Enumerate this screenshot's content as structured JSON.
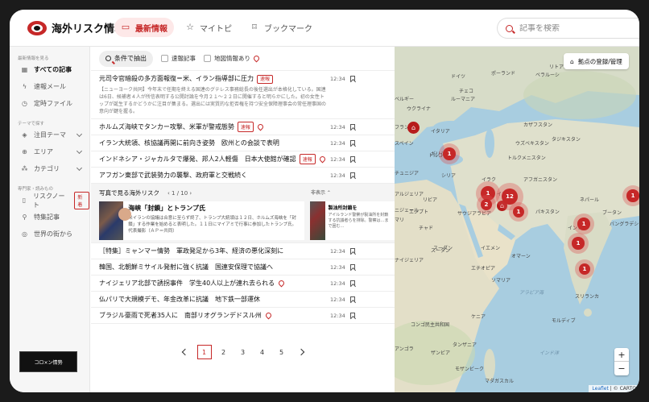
{
  "header": {
    "logo_text": "海外リスク情報",
    "nav": [
      {
        "label": "最新情報",
        "icon": "monitor-icon",
        "active": true
      },
      {
        "label": "マイトピ",
        "icon": "star-icon",
        "active": false
      },
      {
        "label": "ブックマーク",
        "icon": "bookmark-icon",
        "active": false
      }
    ],
    "search_placeholder": "記事を検索"
  },
  "sidebar": {
    "section1_label": "最新情報を見る",
    "items1": [
      {
        "label": "すべての記事",
        "icon": "grid-icon"
      },
      {
        "label": "速報メール",
        "icon": "bolt-icon"
      },
      {
        "label": "定時ファイル",
        "icon": "clock-icon"
      }
    ],
    "section2_label": "テーマで探す",
    "items2": [
      {
        "label": "注目テーマ",
        "icon": "tag-icon"
      },
      {
        "label": "エリア",
        "icon": "globe-icon"
      },
      {
        "label": "カテゴリ",
        "icon": "category-icon"
      }
    ],
    "section3_label": "専門家・読みもの",
    "items3": [
      {
        "label": "リスクノート",
        "icon": "note-icon",
        "badge": "新着"
      },
      {
        "label": "特集記事",
        "icon": "medal-icon"
      },
      {
        "label": "世界の街から",
        "icon": "globe2-icon"
      }
    ],
    "banner_text": "コロ×ン情勢"
  },
  "feed": {
    "filter_button": "条件で抽出",
    "check_breaking": "速報記事",
    "check_map": "地図情報あり",
    "news_top": [
      {
        "title": "元司令官暗殺の多方面報復＝米、イラン指導部に圧力",
        "time": "12:34",
        "tag": "速報",
        "pin": false
      }
    ],
    "expanded": {
      "title": "元司令官暗殺の多方面報復＝米、イラン指導部に圧力",
      "time": "12:34",
      "body": "【ニューヨーク共同】今年末で任期を終える国連のグテレス事務総長の後任選出が本格化している。国連は6日、候補者４人が所信表明する公開討論を今月２１～２２日に開催すると明らかにした。初の女性トップが誕生するかどうかに注目が集まる。選出には実質的な拒否権を持つ安全保障理事会の常任理事国の意向が鍵を握る。"
    },
    "news_mid": [
      {
        "title": "ホルムズ海峡でタンカー攻撃、米軍が警戒態勢",
        "time": "12:34",
        "tag": "速報",
        "pin": true
      },
      {
        "title": "イラン大統領、核協議再開に前向き姿勢　欧州との会談で表明",
        "time": "12:34",
        "tag": "",
        "pin": false
      },
      {
        "title": "インドネシア・ジャカルタで爆発、邦人2人軽傷　日本大使館が確認",
        "time": "12:34",
        "tag": "速報",
        "pin": true
      },
      {
        "title": "アフガン東部で武装勢力の襲撃、政府軍と交戦続く",
        "time": "12:34",
        "tag": "",
        "pin": false
      }
    ],
    "photo": {
      "heading": "写真で見る海外リスク",
      "pager": "1 / 10",
      "hide_label": "非表示",
      "card1_title": "海峡「封鎖」とトランプ氏",
      "card1_body": "米イランの協議は合意に至らず終了、トランプ大統領は１２日、ホルムズ海峡を「封鎖」する作業を始めると表明した。１１日にマイアミで行事に参加したトランプ氏。代表撮影（ＡＰ＝共同）",
      "card2_title": "製油所封鎖を",
      "card2_body": "アイルランド警察が製油所を封鎖する抗議者らを排除。警察は…まで囲む…"
    },
    "news_bottom": [
      {
        "title": "［特集］ミャンマー情勢　軍政発足から3年、経済の悪化深刻に",
        "time": "12:34",
        "tag": "",
        "pin": false
      },
      {
        "title": "韓国、北朝鮮ミサイル発射に強く抗議　国連安保理で協議へ",
        "time": "12:34",
        "tag": "",
        "pin": false
      },
      {
        "title": "ナイジェリア北部で誘拐事件　学生40人以上が連れ去られる",
        "time": "12:34",
        "tag": "",
        "pin": true
      },
      {
        "title": "仏パリで大規模デモ、年金改革に抗議　地下鉄一部運休",
        "time": "12:34",
        "tag": "",
        "pin": false
      },
      {
        "title": "ブラジル豪雨で死者35人に　南部リオグランデドスル州",
        "time": "12:34",
        "tag": "",
        "pin": true
      }
    ],
    "pages": [
      "1",
      "2",
      "3",
      "4",
      "5"
    ]
  },
  "map": {
    "base_button": "拠点の登録/管理",
    "labels": [
      {
        "text": "ドイツ",
        "sea": false
      },
      {
        "text": "ポーランド",
        "sea": false
      },
      {
        "text": "ベラルーシ",
        "sea": false
      },
      {
        "text": "チェコ",
        "sea": false
      },
      {
        "text": "ウクライナ",
        "sea": false
      },
      {
        "text": "フランス",
        "sea": false
      },
      {
        "text": "イタリア",
        "sea": false
      },
      {
        "text": "スペイン",
        "sea": false
      },
      {
        "text": "ギリシャ",
        "sea": false
      },
      {
        "text": "トルコ",
        "sea": false
      },
      {
        "text": "シリア",
        "sea": false
      },
      {
        "text": "チュニジア",
        "sea": false
      },
      {
        "text": "アルジェリア",
        "sea": false
      },
      {
        "text": "リビア",
        "sea": false
      },
      {
        "text": "エジプト",
        "sea": false
      },
      {
        "text": "サウジアラビア",
        "sea": false
      },
      {
        "text": "イラン",
        "sea": false
      },
      {
        "text": "イラク",
        "sea": false
      },
      {
        "text": "カザフスタン",
        "sea": false
      },
      {
        "text": "ウズベキスタン",
        "sea": false
      },
      {
        "text": "トルクメニスタン",
        "sea": false
      },
      {
        "text": "アフガニスタン",
        "sea": false
      },
      {
        "text": "パキスタン",
        "sea": false
      },
      {
        "text": "インド",
        "sea": false
      },
      {
        "text": "ネパール",
        "sea": false
      },
      {
        "text": "スーダン",
        "sea": false
      },
      {
        "text": "エチオピア",
        "sea": false
      },
      {
        "text": "スーダン",
        "sea": false
      },
      {
        "text": "ソマリア",
        "sea": false
      },
      {
        "text": "ケニア",
        "sea": false
      },
      {
        "text": "タンザニア",
        "sea": false
      },
      {
        "text": "ニジェール",
        "sea": false
      },
      {
        "text": "チャド",
        "sea": false
      },
      {
        "text": "マリ",
        "sea": false
      },
      {
        "text": "ナイジェリア",
        "sea": false
      },
      {
        "text": "コンゴ民主共和国",
        "sea": false
      },
      {
        "text": "アンゴラ",
        "sea": false
      },
      {
        "text": "ザンビア",
        "sea": false
      },
      {
        "text": "モザンビーク",
        "sea": false
      },
      {
        "text": "マダガスカル",
        "sea": false
      },
      {
        "text": "スリランカ",
        "sea": false
      },
      {
        "text": "イエメン",
        "sea": false
      },
      {
        "text": "オマーン",
        "sea": false
      },
      {
        "text": "タジキスタン",
        "sea": false
      },
      {
        "text": "バングラデシュ",
        "sea": false
      },
      {
        "text": "モルディブ",
        "sea": false
      },
      {
        "text": "ルーマニア",
        "sea": false
      },
      {
        "text": "ベルギー",
        "sea": false
      },
      {
        "text": "エストニア",
        "sea": false
      },
      {
        "text": "リトアニア",
        "sea": false
      },
      {
        "text": "ロシア",
        "sea": false
      },
      {
        "text": "アラビア海",
        "sea": true
      },
      {
        "text": "インド洋",
        "sea": true
      },
      {
        "text": "ブータン",
        "sea": false
      }
    ],
    "clusters": [
      "1",
      "1",
      "2",
      "12",
      "1",
      "1",
      "1",
      "1",
      "1"
    ],
    "zoom_in": "+",
    "zoom_out": "−",
    "attribution_leaflet": "Leaflet",
    "attribution_carto": "| © CARTO"
  }
}
